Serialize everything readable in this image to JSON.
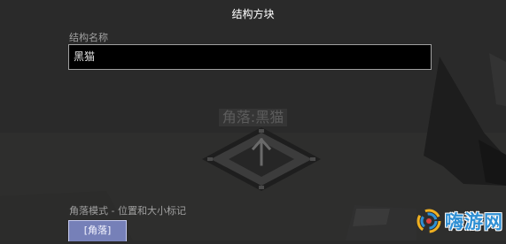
{
  "screen": {
    "title": "结构方块"
  },
  "name_field": {
    "label": "结构名称",
    "value": "黑猫"
  },
  "world_marker": {
    "label": "角落:黑猫"
  },
  "mode": {
    "description": "角落模式 - 位置和大小标记",
    "button_label": "[角落]"
  },
  "watermark": {
    "text": "嗨游网"
  },
  "colors": {
    "background": "#2a2a2a",
    "input_background": "#000000",
    "input_border": "#a0a0a0",
    "title_text": "#ffffff",
    "label_text": "#a0a0a0",
    "button_fill": "#7680b8",
    "button_border": "#c8ccf0",
    "watermark_blue": "#2f8fd4"
  },
  "icons": {
    "structure_block": "structure-block-corner-icon",
    "watermark_logo": "watermark-logo-icon"
  }
}
